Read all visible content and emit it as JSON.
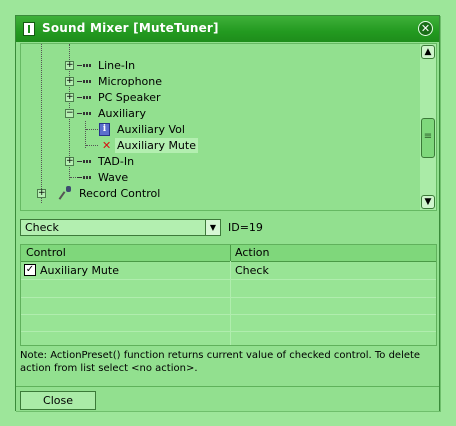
{
  "window": {
    "title": "Sound Mixer [MuteTuner]"
  },
  "tree": {
    "items": [
      {
        "label": "Line-In"
      },
      {
        "label": "Microphone"
      },
      {
        "label": "PC Speaker"
      },
      {
        "label": "Auxiliary"
      },
      {
        "label": "Auxiliary Vol"
      },
      {
        "label": "Auxiliary Mute"
      },
      {
        "label": "TAD-In"
      },
      {
        "label": "Wave"
      },
      {
        "label": "Record Control"
      }
    ]
  },
  "action_select": {
    "value": "Check"
  },
  "id_label": "ID=19",
  "grid": {
    "columns": [
      "Control",
      "Action"
    ],
    "rows": [
      {
        "control": "Auxiliary Mute",
        "action": "Check",
        "checked": true
      }
    ]
  },
  "note": "Note: ActionPreset() function returns current value of checked control. To delete action from list select <no action>.",
  "buttons": {
    "close": "Close"
  }
}
